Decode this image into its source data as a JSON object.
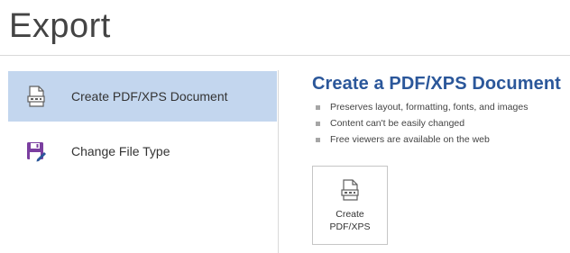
{
  "page": {
    "title": "Export"
  },
  "nav": {
    "items": [
      {
        "label": "Create PDF/XPS Document",
        "icon": "pdf-document-icon",
        "selected": true
      },
      {
        "label": "Change File Type",
        "icon": "save-as-icon",
        "selected": false
      }
    ]
  },
  "details": {
    "title": "Create a PDF/XPS Document",
    "bullets": [
      "Preserves layout, formatting, fonts, and images",
      "Content can't be easily changed",
      "Free viewers are available on the web"
    ],
    "button": {
      "line1": "Create",
      "line2": "PDF/XPS",
      "icon": "pdf-document-icon"
    }
  },
  "colors": {
    "accent": "#2b579a",
    "selected_bg": "#c3d6ee",
    "save_icon": "#7b3fa0"
  }
}
